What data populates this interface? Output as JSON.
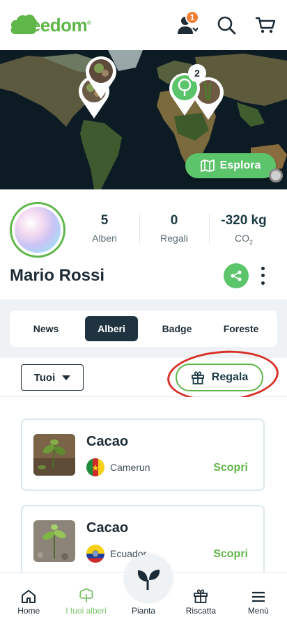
{
  "header": {
    "logo_text": "treedom",
    "notification_count": "1"
  },
  "map": {
    "cluster_count": "2",
    "explore_label": "Esplora"
  },
  "profile": {
    "name": "Mario Rossi",
    "stats": [
      {
        "value": "5",
        "label": "Alberi"
      },
      {
        "value": "0",
        "label": "Regali"
      },
      {
        "value": "-320 kg",
        "label": "CO",
        "label_sub": "2"
      }
    ]
  },
  "tabs": [
    {
      "label": "News",
      "active": false
    },
    {
      "label": "Alberi",
      "active": true
    },
    {
      "label": "Badge",
      "active": false
    },
    {
      "label": "Foreste",
      "active": false
    }
  ],
  "filter": {
    "select_value": "Tuoi",
    "gift_label": "Regala"
  },
  "trees": [
    {
      "name": "Cacao",
      "country": "Camerun",
      "action": "Scopri"
    },
    {
      "name": "Cacao",
      "country": "Ecuador",
      "action": "Scopri"
    }
  ],
  "bottom_nav": [
    {
      "label": "Home",
      "icon": "home-icon",
      "active": false
    },
    {
      "label": "I tuoi alberi",
      "icon": "tree-icon",
      "active": true
    },
    {
      "label": "Pianta",
      "icon": "sprout-icon",
      "active": false
    },
    {
      "label": "Riscatta",
      "icon": "gift-icon",
      "active": false
    },
    {
      "label": "Menù",
      "icon": "menu-icon",
      "active": false
    }
  ],
  "colors": {
    "brand_green": "#5fb649",
    "dark_navy": "#1f3440",
    "badge_orange": "#f07e32",
    "highlight_red": "#d9312a"
  }
}
